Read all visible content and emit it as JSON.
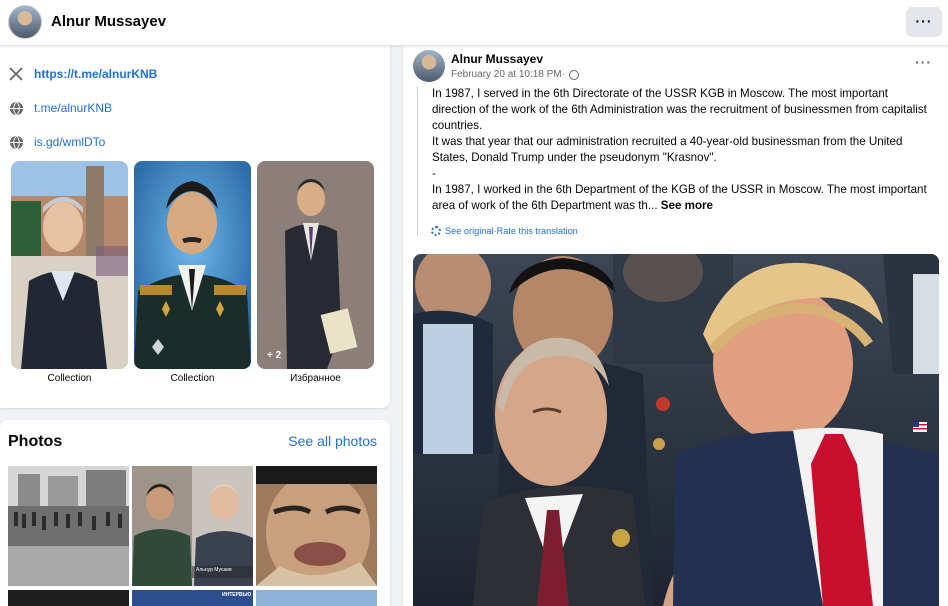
{
  "profile": {
    "name": "Alnur Mussayev"
  },
  "intro": {
    "cut_text": "··· ···· ··· ··· · ··· ·",
    "links": [
      {
        "icon": "x-icon",
        "text": "https://t.me/alnurKNB"
      },
      {
        "icon": "globe-icon",
        "text": "t.me/alnurKNB"
      },
      {
        "icon": "globe-icon",
        "text": "is.gd/wmlDTo"
      }
    ],
    "collections": [
      {
        "label": "Collection"
      },
      {
        "label": "Collection"
      },
      {
        "label": "Избранное",
        "extra_count": "+ 2"
      }
    ]
  },
  "photos": {
    "title": "Photos",
    "see_all": "See all photos",
    "thumb_caption": "Альнур Мусаев",
    "thumb_banner": "ИНТЕРВЬЮ"
  },
  "post": {
    "author": "Alnur Mussayev",
    "date": "February 20 at 10:18 PM",
    "separator": " · ",
    "paragraphs": [
      "In 1987, I served in the 6th Directorate of the USSR KGB in Moscow. The most important direction of the work of the 6th Administration was the recruitment of businessmen from capitalist countries.",
      "It was that year that our administration recruited a 40-year-old businessman from the United States, Donald Trump under the pseudonym \"Krasnov\".",
      "-",
      "In 1987, I worked in the 6th Department of the KGB of the USSR in Moscow. The most important area of   work of the 6th Department was th..."
    ],
    "see_more": "See more",
    "see_original": "See original",
    "rate_translation": "Rate this translation",
    "translate_separator": " · "
  },
  "colors": {
    "link": "#216fdb",
    "tie_red": "#c8102e",
    "bg": "#f0f2f5"
  }
}
